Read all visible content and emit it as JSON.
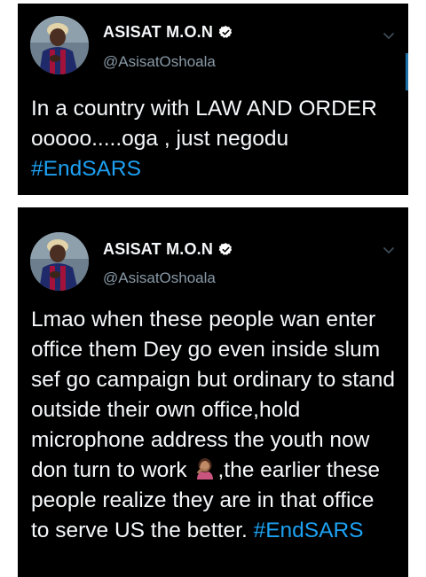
{
  "tweets": [
    {
      "display_name": "ASISAT M.O.N",
      "handle": "@AsisatOshoala",
      "verified_icon": "verified-badge-icon",
      "menu_icon": "chevron-down-icon",
      "text_before": "In a country with LAW AND ORDER ooooo.....oga , just negodu ",
      "hashtag": "#EndSARS",
      "text_after": ""
    },
    {
      "display_name": "ASISAT M.O.N",
      "handle": "@AsisatOshoala",
      "verified_icon": "verified-badge-icon",
      "menu_icon": "chevron-down-icon",
      "text_before": "Lmao when these people wan enter office them Dey go even inside slum sef go campaign but ordinary to stand outside their own office,hold microphone address the youth now don turn to work ",
      "emoji": "woman-facepalming-emoji",
      "text_middle": ",the earlier these people realize they are in that office to serve US the better. ",
      "hashtag": "#EndSARS"
    }
  ],
  "colors": {
    "background": "#000000",
    "text": "#f5f8fa",
    "secondary_text": "#8899a6",
    "hashtag": "#1da1f2",
    "verified": "#ffffff"
  }
}
